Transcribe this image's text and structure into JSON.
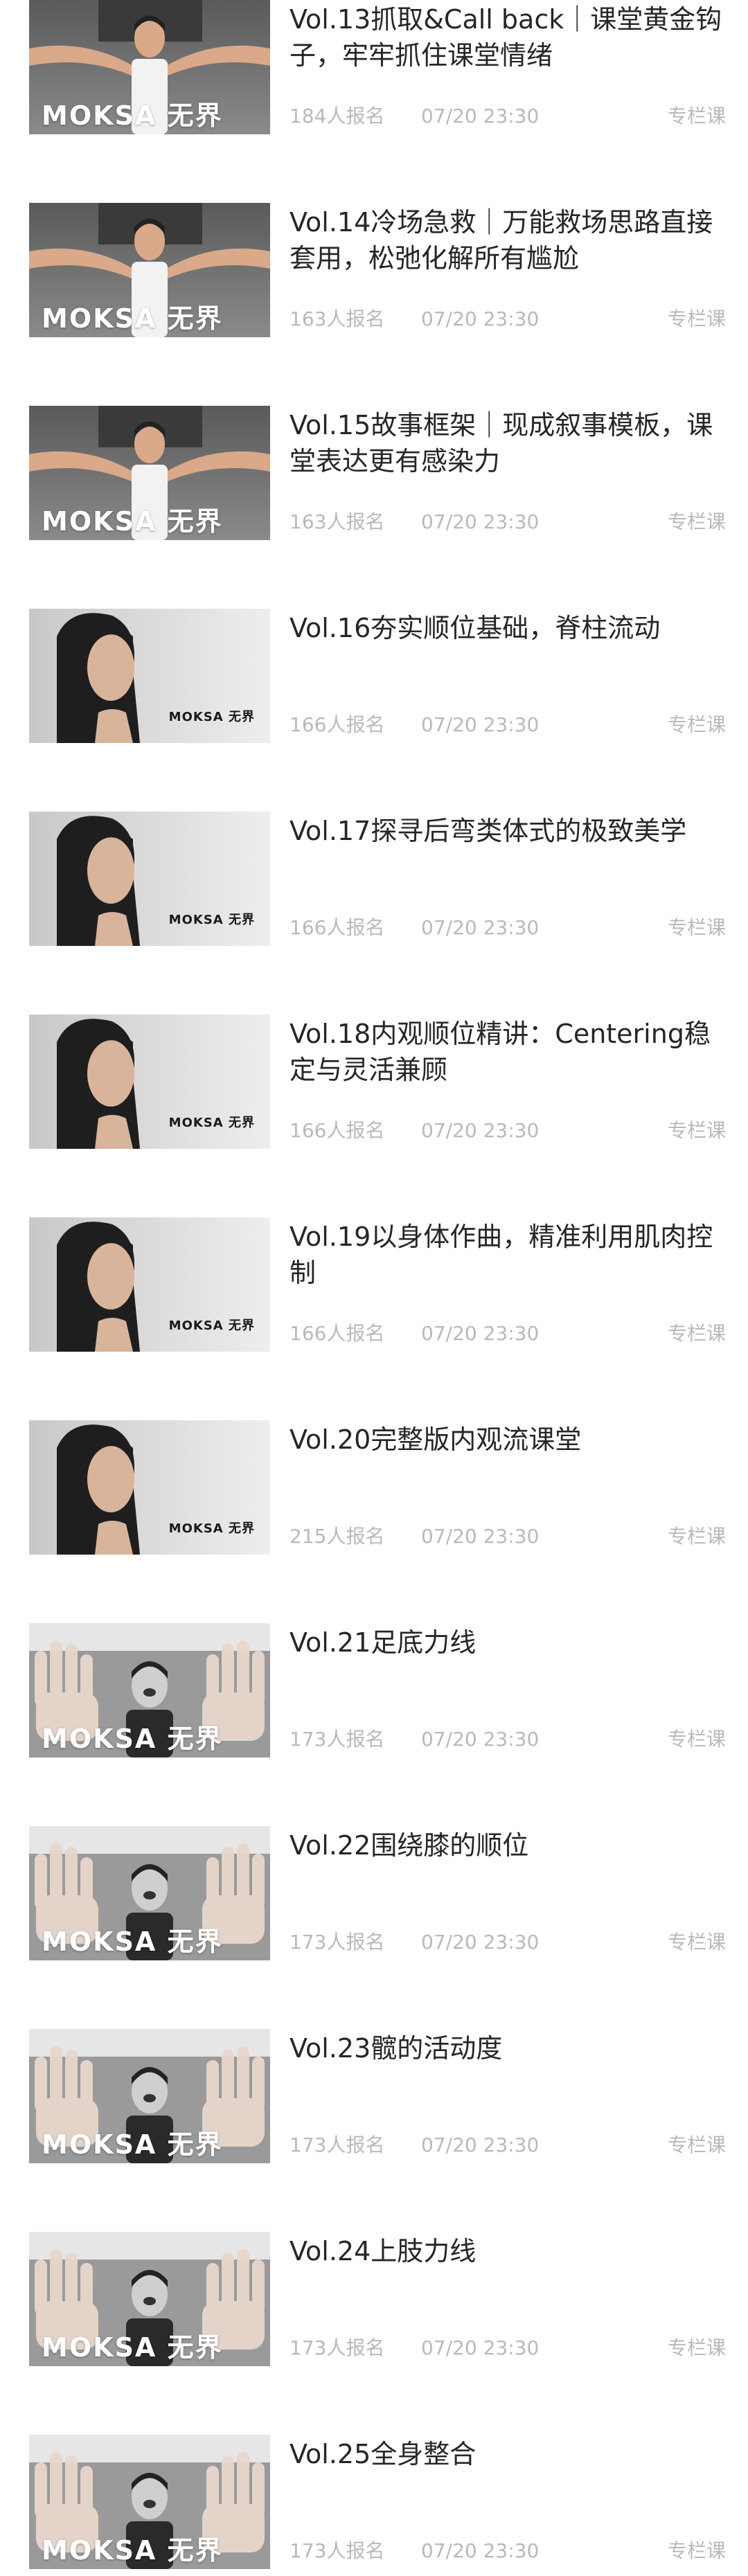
{
  "courses": [
    {
      "title": "Vol.13抓取&Call back｜课堂黄金钩子，牢牢抓住课堂情绪",
      "enrolled": "184人报名",
      "date": "07/20 23:30",
      "tag": "专栏课",
      "thumb": "arms",
      "brand": "MOKSA 无界"
    },
    {
      "title": "Vol.14冷场急救｜万能救场思路直接套用，松弛化解所有尴尬",
      "enrolled": "163人报名",
      "date": "07/20 23:30",
      "tag": "专栏课",
      "thumb": "arms",
      "brand": "MOKSA 无界"
    },
    {
      "title": "Vol.15故事框架｜现成叙事模板，课堂表达更有感染力",
      "enrolled": "163人报名",
      "date": "07/20 23:30",
      "tag": "专栏课",
      "thumb": "arms",
      "brand": "MOKSA 无界"
    },
    {
      "title": "Vol.16夯实顺位基础，脊柱流动",
      "enrolled": "166人报名",
      "date": "07/20 23:30",
      "tag": "专栏课",
      "thumb": "portrait",
      "brand": "MOKSA 无界"
    },
    {
      "title": "Vol.17探寻后弯类体式的极致美学",
      "enrolled": "166人报名",
      "date": "07/20 23:30",
      "tag": "专栏课",
      "thumb": "portrait",
      "brand": "MOKSA 无界"
    },
    {
      "title": "Vol.18内观顺位精讲：Centering稳定与灵活兼顾",
      "enrolled": "166人报名",
      "date": "07/20 23:30",
      "tag": "专栏课",
      "thumb": "portrait",
      "brand": "MOKSA 无界"
    },
    {
      "title": "Vol.19以身体作曲，精准利用肌肉控制",
      "enrolled": "166人报名",
      "date": "07/20 23:30",
      "tag": "专栏课",
      "thumb": "portrait",
      "brand": "MOKSA 无界"
    },
    {
      "title": "Vol.20完整版内观流课堂",
      "enrolled": "215人报名",
      "date": "07/20 23:30",
      "tag": "专栏课",
      "thumb": "portrait",
      "brand": "MOKSA 无界"
    },
    {
      "title": "Vol.21足底力线",
      "enrolled": "173人报名",
      "date": "07/20 23:30",
      "tag": "专栏课",
      "thumb": "hands",
      "brand": "MOKSA 无界"
    },
    {
      "title": "Vol.22围绕膝的顺位",
      "enrolled": "173人报名",
      "date": "07/20 23:30",
      "tag": "专栏课",
      "thumb": "hands",
      "brand": "MOKSA 无界"
    },
    {
      "title": "Vol.23髋的活动度",
      "enrolled": "173人报名",
      "date": "07/20 23:30",
      "tag": "专栏课",
      "thumb": "hands",
      "brand": "MOKSA 无界"
    },
    {
      "title": "Vol.24上肢力线",
      "enrolled": "173人报名",
      "date": "07/20 23:30",
      "tag": "专栏课",
      "thumb": "hands",
      "brand": "MOKSA 无界"
    },
    {
      "title": "Vol.25全身整合",
      "enrolled": "173人报名",
      "date": "07/20 23:30",
      "tag": "专栏课",
      "thumb": "hands",
      "brand": "MOKSA 无界"
    }
  ]
}
